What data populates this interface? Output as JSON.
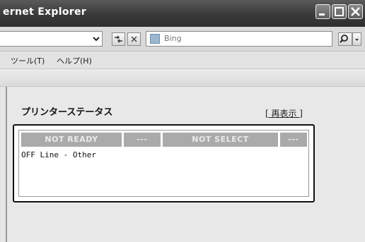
{
  "window": {
    "title": "ernet Explorer"
  },
  "toolbar": {
    "search_placeholder": "Bing"
  },
  "menu": {
    "items": [
      {
        "label": "ツール(T)"
      },
      {
        "label": "ヘルプ(H)"
      }
    ]
  },
  "page": {
    "heading": "プリンターステータス",
    "refresh_label": "[ 再表示 ]",
    "status_columns": [
      "NOT READY",
      "---",
      "NOT SELECT",
      "---"
    ],
    "message": "OFF Line - Other"
  }
}
